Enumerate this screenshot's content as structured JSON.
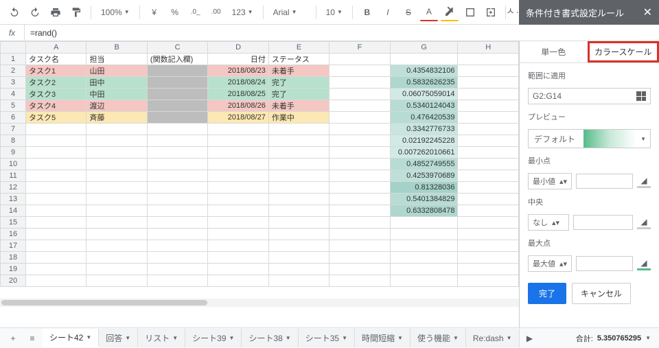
{
  "toolbar": {
    "zoom": "100%",
    "font": "Arial",
    "fontsize": "10",
    "format123": "123"
  },
  "fx": {
    "label": "fx",
    "value": "=rand()"
  },
  "cols": [
    "A",
    "B",
    "C",
    "D",
    "E",
    "F",
    "G",
    "H"
  ],
  "rows": [
    {
      "n": 1,
      "A": "タスク名",
      "B": "担当",
      "C": "(関数記入欄)",
      "D": "日付",
      "E": "ステータス",
      "F": "",
      "G": "",
      "H": ""
    },
    {
      "n": 2,
      "A": "タスク1",
      "B": "山田",
      "C": "",
      "D": "2018/08/23",
      "E": "未着手",
      "F": "",
      "G": "0.4354832106",
      "H": "",
      "aBg": "bg-red",
      "bBg": "bg-red",
      "cBg": "bg-grey",
      "dBg": "bg-red",
      "eBg": "bg-red",
      "gBg": "g-3"
    },
    {
      "n": 3,
      "A": "タスク2",
      "B": "田中",
      "C": "",
      "D": "2018/08/24",
      "E": "完了",
      "F": "",
      "G": "0.5832626235",
      "H": "",
      "aBg": "bg-green",
      "bBg": "bg-green",
      "cBg": "bg-grey",
      "dBg": "bg-green",
      "eBg": "bg-green",
      "gBg": "g-5"
    },
    {
      "n": 4,
      "A": "タスク3",
      "B": "中田",
      "C": "",
      "D": "2018/08/25",
      "E": "完了",
      "F": "",
      "G": "0.06075059014",
      "H": "",
      "aBg": "bg-green",
      "bBg": "bg-green",
      "cBg": "bg-grey",
      "dBg": "bg-green",
      "eBg": "bg-green",
      "gBg": "g-1"
    },
    {
      "n": 5,
      "A": "タスク4",
      "B": "渡辺",
      "C": "",
      "D": "2018/08/26",
      "E": "未着手",
      "F": "",
      "G": "0.5340124043",
      "H": "",
      "aBg": "bg-red",
      "bBg": "bg-red",
      "cBg": "bg-grey",
      "dBg": "bg-red",
      "eBg": "bg-red",
      "gBg": "g-4"
    },
    {
      "n": 6,
      "A": "タスク5",
      "B": "斉藤",
      "C": "",
      "D": "2018/08/27",
      "E": "作業中",
      "F": "",
      "G": "0.476420539",
      "H": "",
      "aBg": "bg-yellow",
      "bBg": "bg-yellow",
      "cBg": "bg-grey",
      "dBg": "bg-yellow",
      "eBg": "bg-yellow",
      "gBg": "g-4"
    },
    {
      "n": 7,
      "G": "0.3342776733",
      "gBg": "g-2"
    },
    {
      "n": 8,
      "G": "0.02192245228",
      "gBg": "g-1"
    },
    {
      "n": 9,
      "G": "0.007262010661",
      "gBg": "g-1"
    },
    {
      "n": 10,
      "G": "0.4852749555",
      "gBg": "g-4"
    },
    {
      "n": 11,
      "G": "0.4253970689",
      "gBg": "g-3"
    },
    {
      "n": 12,
      "G": "0.81328036",
      "gBg": "g-6"
    },
    {
      "n": 13,
      "G": "0.5401384829",
      "gBg": "g-4"
    },
    {
      "n": 14,
      "G": "0.6332808478",
      "gBg": "g-5"
    },
    {
      "n": 15
    },
    {
      "n": 16
    },
    {
      "n": 17
    },
    {
      "n": 18
    },
    {
      "n": 19
    },
    {
      "n": 20
    }
  ],
  "sidebar": {
    "title": "条件付き書式設定ルール",
    "tab_single": "単一色",
    "tab_scale": "カラースケール",
    "range_label": "範囲に適用",
    "range_value": "G2:G14",
    "preview_label": "プレビュー",
    "preview_value": "デフォルト",
    "min_label": "最小点",
    "min_select": "最小値",
    "mid_label": "中央",
    "mid_select": "なし",
    "max_label": "最大点",
    "max_select": "最大値",
    "done": "完了",
    "cancel": "キャンセル"
  },
  "tabs": [
    {
      "label": "シート42",
      "active": true
    },
    {
      "label": "回答"
    },
    {
      "label": "リスト"
    },
    {
      "label": "シート39"
    },
    {
      "label": "シート38"
    },
    {
      "label": "シート35"
    },
    {
      "label": "時間短縮"
    },
    {
      "label": "使う機能"
    },
    {
      "label": "Re:dash"
    }
  ],
  "footer": {
    "sum_label": "合計:",
    "sum_value": "5.350765295"
  }
}
